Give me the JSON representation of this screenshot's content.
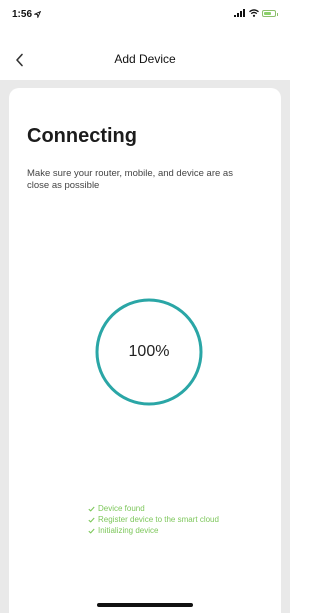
{
  "status_bar": {
    "time": "1:56",
    "location_icon": "location-arrow-icon",
    "signal_icon": "cellular-signal-icon",
    "wifi_icon": "wifi-icon",
    "battery_icon": "battery-charging-icon",
    "battery_color": "#8bd06a"
  },
  "nav": {
    "back_icon": "chevron-left-icon",
    "title": "Add Device"
  },
  "card": {
    "title": "Connecting",
    "subtitle": "Make sure your router, mobile, and device are as close as possible"
  },
  "progress": {
    "label": "100%",
    "value_percent": 100,
    "ring_color": "#2aa6a6"
  },
  "steps": [
    {
      "label": "Device found",
      "icon": "check-icon"
    },
    {
      "label": "Register device to the smart cloud",
      "icon": "check-icon"
    },
    {
      "label": "Initializing device",
      "icon": "check-icon"
    }
  ],
  "colors": {
    "success_green": "#7dc75b",
    "background_gray": "#e9e9e9"
  }
}
